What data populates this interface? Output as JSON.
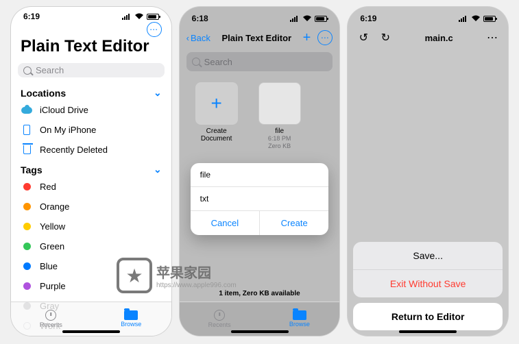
{
  "phone1": {
    "time": "6:19",
    "title": "Plain Text Editor",
    "search_placeholder": "Search",
    "sections": {
      "locations": {
        "header": "Locations",
        "items": [
          {
            "icon": "cloud",
            "label": "iCloud Drive"
          },
          {
            "icon": "iphone",
            "label": "On My iPhone"
          },
          {
            "icon": "trash",
            "label": "Recently Deleted"
          }
        ]
      },
      "tags": {
        "header": "Tags",
        "items": [
          {
            "color": "#ff3b30",
            "label": "Red"
          },
          {
            "color": "#ff9500",
            "label": "Orange"
          },
          {
            "color": "#ffcc00",
            "label": "Yellow"
          },
          {
            "color": "#34c759",
            "label": "Green"
          },
          {
            "color": "#007aff",
            "label": "Blue"
          },
          {
            "color": "#af52de",
            "label": "Purple"
          },
          {
            "color": "#8e8e93",
            "label": "Gray"
          },
          {
            "color": "",
            "label": "Work"
          }
        ]
      }
    },
    "tabs": {
      "recents": "Recents",
      "browse": "Browse"
    }
  },
  "phone2": {
    "time": "6:18",
    "back": "Back",
    "title": "Plain Text Editor",
    "search_placeholder": "Search",
    "grid": {
      "create": {
        "label": "Create Document"
      },
      "file": {
        "label": "file",
        "time": "6:18 PM",
        "size": "Zero KB"
      }
    },
    "modal": {
      "name": "file",
      "ext": "txt",
      "cancel": "Cancel",
      "create": "Create"
    },
    "footer": "1 item, Zero KB available",
    "tabs": {
      "recents": "Recents",
      "browse": "Browse"
    }
  },
  "phone3": {
    "time": "6:19",
    "title": "main.c",
    "sheet": {
      "save": "Save...",
      "exit": "Exit Without Save",
      "return": "Return to Editor"
    }
  },
  "watermark": {
    "text": "苹果家园",
    "url": "https://www.apple996.com"
  }
}
